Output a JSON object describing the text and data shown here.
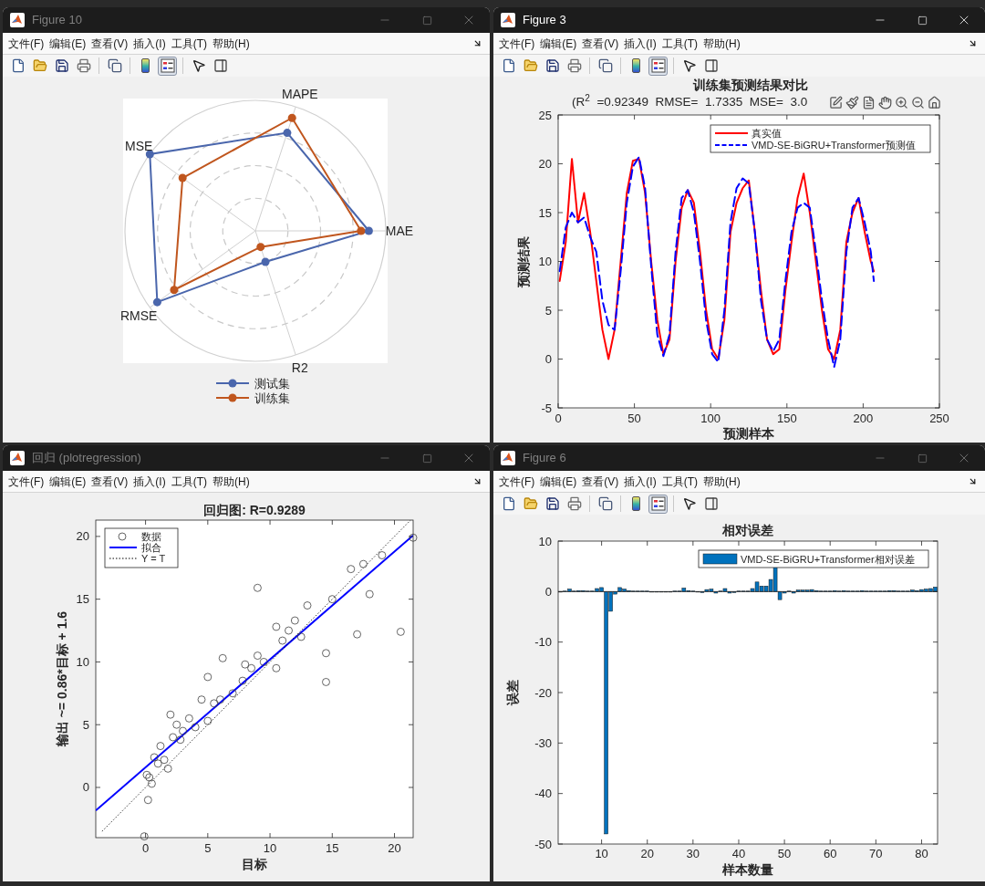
{
  "windows": [
    {
      "title": "Figure 10",
      "active": false,
      "menu": [
        "文件(F)",
        "编辑(E)",
        "查看(V)",
        "插入(I)",
        "工具(T)",
        "帮助(H)"
      ],
      "toolbar": [
        {
          "kind": "new",
          "selected": false
        },
        {
          "kind": "open",
          "selected": false
        },
        {
          "kind": "save",
          "selected": false
        },
        {
          "kind": "print",
          "selected": false
        },
        {
          "kind": "preview",
          "selected": false
        },
        {
          "kind": "colorbar",
          "selected": false
        },
        {
          "kind": "legend",
          "selected": true
        },
        {
          "kind": "pointer",
          "selected": false
        },
        {
          "kind": "inspector",
          "selected": false
        }
      ],
      "content": {
        "kind": "radar",
        "axes": [
          "MAE",
          "MAPE",
          "MSE",
          "RMSE",
          "R2"
        ],
        "legend": [
          {
            "label": "测试集",
            "color": "#4a66ac"
          },
          {
            "label": "训练集",
            "color": "#c0561e"
          }
        ]
      }
    },
    {
      "title": "Figure 3",
      "active": true,
      "menu": [
        "文件(F)",
        "编辑(E)",
        "查看(V)",
        "插入(I)",
        "工具(T)",
        "帮助(H)"
      ],
      "toolbar": [
        {
          "kind": "new",
          "selected": false
        },
        {
          "kind": "open",
          "selected": false
        },
        {
          "kind": "save",
          "selected": false
        },
        {
          "kind": "print",
          "selected": false
        },
        {
          "kind": "preview",
          "selected": false
        },
        {
          "kind": "colorbar",
          "selected": false
        },
        {
          "kind": "legend",
          "selected": true
        },
        {
          "kind": "pointer",
          "selected": false
        },
        {
          "kind": "inspector",
          "selected": false
        }
      ],
      "content": {
        "subtitle": "(R$^{2}$  =0.92349  RMSE=  1.7335  MSE=  3.0",
        "chart_data": {
          "type": "line",
          "title": "训练集预测结果对比",
          "xlabel": "预测样本",
          "ylabel": "预测结果",
          "x": [
            1,
            5,
            9,
            13,
            17,
            21,
            25,
            29,
            33,
            37,
            41,
            45,
            49,
            53,
            57,
            61,
            65,
            69,
            73,
            77,
            81,
            85,
            89,
            93,
            97,
            101,
            105,
            109,
            113,
            117,
            121,
            125,
            129,
            133,
            137,
            141,
            145,
            149,
            153,
            157,
            161,
            165,
            169,
            173,
            177,
            181,
            185,
            189,
            193,
            197,
            201,
            205,
            207
          ],
          "series": [
            {
              "name": "真实值",
              "color": "#ff0000",
              "line_style": "solid",
              "values": [
                8,
                12,
                20.5,
                14,
                17,
                13,
                8,
                3,
                0,
                3,
                10,
                17,
                20.3,
                20.5,
                17,
                10,
                4,
                0.5,
                2,
                10,
                15.5,
                17.3,
                16,
                11,
                5,
                1,
                0,
                4,
                13,
                16,
                17.5,
                18.3,
                13,
                7,
                2,
                0.5,
                1,
                7,
                12,
                16.5,
                19,
                15,
                10,
                5,
                1,
                0,
                3,
                12,
                15,
                16.5,
                13,
                10,
                9
              ]
            },
            {
              "name": "VMD-SE-BiGRU+Transformer预测值",
              "color": "#0000ff",
              "line_style": "dashed",
              "values": [
                9,
                13.5,
                15,
                14,
                14.5,
                12.5,
                11,
                6,
                3.5,
                3,
                9,
                16,
                19.7,
                20.7,
                17.5,
                9.5,
                2.5,
                0.3,
                2.5,
                11,
                16.5,
                17.3,
                15,
                10,
                4,
                0.5,
                -0.3,
                5,
                14,
                17.5,
                18.5,
                18,
                13,
                6,
                2,
                0.8,
                2,
                8,
                13,
                15.5,
                16,
                15.5,
                11,
                6,
                2,
                -0.8,
                2,
                11,
                15.5,
                16.5,
                14,
                11,
                8
              ]
            }
          ],
          "legend": true,
          "xlim": [
            0,
            250
          ],
          "ylim": [
            -5,
            25
          ],
          "xticks": [
            0,
            50,
            100,
            150,
            200,
            250
          ],
          "yticks": [
            -5,
            0,
            5,
            10,
            15,
            20,
            25
          ]
        }
      }
    },
    {
      "title": "回归 (plotregression)",
      "active": false,
      "menu": [
        "文件(F)",
        "编辑(E)",
        "查看(V)",
        "插入(I)",
        "工具(T)",
        "帮助(H)"
      ],
      "content": {
        "chart_data": {
          "type": "scatter",
          "title": "回归图: R=0.9289",
          "xlabel": "目标",
          "ylabel": "输出 ~= 0.86*目标 + 1.6",
          "x": [
            -0.1,
            0.1,
            0.2,
            0.3,
            0.5,
            0.7,
            1.0,
            1.2,
            1.5,
            1.8,
            2.0,
            2.2,
            2.5,
            2.8,
            3.0,
            3.5,
            4.0,
            4.5,
            5.0,
            5.0,
            5.5,
            6.0,
            6.2,
            7.0,
            7.8,
            8.0,
            8.5,
            9.0,
            9.0,
            9.5,
            10.5,
            10.5,
            11.0,
            11.5,
            12.0,
            12.5,
            13.0,
            14.5,
            14.5,
            15.0,
            16.5,
            17.0,
            17.5,
            18.0,
            19.0,
            20.5,
            21.5
          ],
          "series": [
            {
              "name": "数据",
              "color": "#404040",
              "values": [
                -3.9,
                1.0,
                -1.0,
                0.8,
                0.3,
                2.4,
                1.9,
                3.3,
                2.2,
                1.5,
                5.8,
                4.0,
                5.0,
                3.8,
                4.5,
                5.5,
                4.8,
                7.0,
                5.3,
                8.8,
                6.7,
                7.0,
                10.3,
                7.5,
                8.5,
                9.8,
                9.5,
                10.5,
                15.9,
                10.0,
                12.8,
                9.5,
                11.7,
                12.5,
                13.3,
                12.0,
                14.5,
                10.7,
                8.4,
                15.0,
                17.4,
                12.2,
                17.8,
                15.4,
                18.5,
                12.4,
                19.9
              ]
            },
            {
              "name": "拟合",
              "type": "line",
              "color": "#0000ff",
              "line_style": "solid",
              "x": [
                -4,
                21.5
              ],
              "values": [
                -1.84,
                20.09
              ]
            },
            {
              "name": "Y = T",
              "type": "line",
              "color": "#000000",
              "line_style": "dotted",
              "x": [
                -3.5,
                21.3
              ],
              "values": [
                -3.5,
                21.3
              ]
            }
          ],
          "legend": true,
          "xlim": [
            -4,
            21.5
          ],
          "ylim": [
            -4,
            21.3
          ],
          "xticks": [
            0,
            5,
            10,
            15,
            20
          ],
          "yticks": [
            0,
            5,
            10,
            15,
            20
          ]
        }
      }
    },
    {
      "title": "Figure 6",
      "active": false,
      "menu": [
        "文件(F)",
        "编辑(E)",
        "查看(V)",
        "插入(I)",
        "工具(T)",
        "帮助(H)"
      ],
      "toolbar": [
        {
          "kind": "new",
          "selected": false
        },
        {
          "kind": "open",
          "selected": false
        },
        {
          "kind": "save",
          "selected": false
        },
        {
          "kind": "print",
          "selected": false
        },
        {
          "kind": "preview",
          "selected": false
        },
        {
          "kind": "colorbar",
          "selected": false
        },
        {
          "kind": "legend",
          "selected": true
        },
        {
          "kind": "pointer",
          "selected": false
        },
        {
          "kind": "inspector",
          "selected": false
        }
      ],
      "content": {
        "chart_data": {
          "type": "bar",
          "title": "相对误差",
          "xlabel": "样本数量",
          "ylabel": "误差",
          "x": [
            1,
            2,
            3,
            4,
            5,
            6,
            7,
            8,
            9,
            10,
            11,
            12,
            13,
            14,
            15,
            16,
            17,
            18,
            19,
            20,
            21,
            22,
            23,
            24,
            25,
            26,
            27,
            28,
            29,
            30,
            31,
            32,
            33,
            34,
            35,
            36,
            37,
            38,
            39,
            40,
            41,
            42,
            43,
            44,
            45,
            46,
            47,
            48,
            49,
            50,
            51,
            52,
            53,
            54,
            55,
            56,
            57,
            58,
            59,
            60,
            61,
            62,
            63,
            64,
            65,
            66,
            67,
            68,
            69,
            70,
            71,
            72,
            73,
            74,
            75,
            76,
            77,
            78,
            79,
            80,
            81,
            82,
            83
          ],
          "series": [
            {
              "name": "VMD-SE-BiGRU+Transformer相对误差",
              "color": "#0072bd",
              "values": [
                0,
                0.1,
                0.5,
                0.1,
                0.2,
                0.2,
                0.1,
                0.1,
                0.6,
                0.8,
                -48,
                -3.9,
                -0.5,
                0.8,
                0.5,
                0.2,
                0.1,
                0.1,
                0.1,
                0.1,
                0,
                0,
                0,
                0,
                0,
                0.1,
                0.1,
                0.7,
                0.2,
                0.1,
                -0.1,
                -0.2,
                0.4,
                0.5,
                -0.3,
                0.1,
                0.6,
                -0.3,
                -0.2,
                0.1,
                0.1,
                0.1,
                0.6,
                1.9,
                1.1,
                1.1,
                2.4,
                5.1,
                -1.6,
                -0.3,
                0.1,
                -0.3,
                0.3,
                0.3,
                0.3,
                0.4,
                0.2,
                0.1,
                0.1,
                0.1,
                0.2,
                0.1,
                0.2,
                0.1,
                0.1,
                0.1,
                0.2,
                0.1,
                0.1,
                0.1,
                0.1,
                0.1,
                0.2,
                0.2,
                0.1,
                0.1,
                0.1,
                0.3,
                0.2,
                0.4,
                0.5,
                0.6,
                0.9
              ]
            }
          ],
          "legend": true,
          "xlim": [
            0.5,
            83.5
          ],
          "ylim": [
            -50,
            10
          ],
          "xticks": [
            10,
            20,
            30,
            40,
            50,
            60,
            70,
            80
          ],
          "yticks": [
            -50,
            -40,
            -30,
            -20,
            -10,
            0,
            10
          ]
        }
      }
    }
  ]
}
